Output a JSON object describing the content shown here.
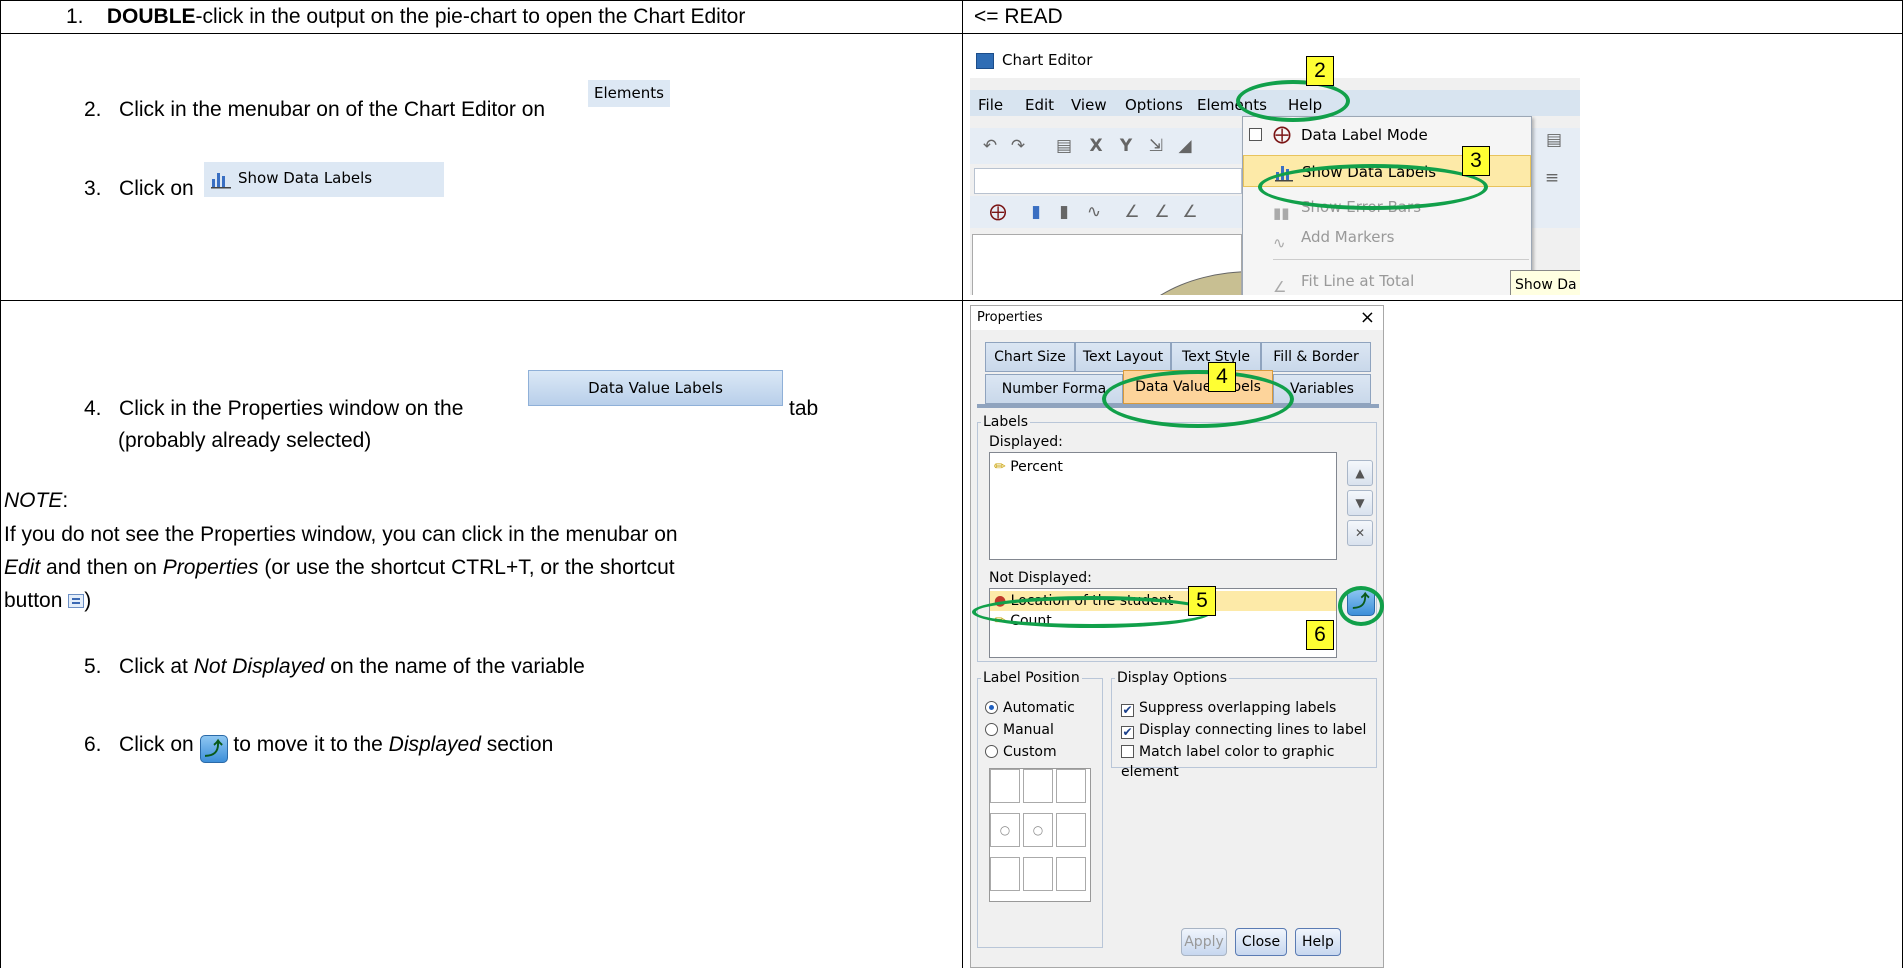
{
  "instructions": {
    "row1": {
      "num": "1.",
      "bold": "DOUBLE",
      "text": "-click in the output on the pie-chart to open the Chart Editor",
      "right": "<= READ"
    },
    "step2": {
      "num": "2.",
      "text": "Click in the menubar on of the Chart Editor on",
      "chip": "Elements"
    },
    "step3": {
      "num": "3.",
      "text": "Click on",
      "chip": "Show Data Labels"
    },
    "step4": {
      "num": "4.",
      "text_before": "Click in the Properties window on the",
      "chip": "Data Value Labels",
      "text_after": "tab",
      "line2": "(probably already selected)"
    },
    "note_label": "NOTE",
    "note_colon": ":",
    "note_line1": "If you do not see the Properties window, you can click in the menubar on",
    "note_edit": "Edit",
    "note_mid": " and then on ",
    "note_properties": "Properties",
    "note_line2_rest": " (or use the shortcut CTRL+T, or the shortcut",
    "note_line3": "button",
    "note_line3_end": ")",
    "step5": {
      "num": "5.",
      "text": "Click at ",
      "italic": "Not Displayed",
      "text_after": " on the name of the variable"
    },
    "step6": {
      "num": "6.",
      "text": "Click on",
      "text_after": " to move it to the ",
      "italic": "Displayed",
      "text_end": " section"
    }
  },
  "chart_editor": {
    "title": "Chart Editor",
    "menus": [
      "File",
      "Edit",
      "View",
      "Options",
      "Elements",
      "Help"
    ],
    "dropdown": {
      "items": [
        "Data Label Mode",
        "Show Data Labels",
        "Show Error Bars",
        "Add Markers",
        "Fit Line at Total"
      ]
    },
    "tooltip": "Show Da"
  },
  "properties": {
    "title": "Properties",
    "close_glyph": "×",
    "tabs_row1": [
      "Chart Size",
      "Text Layout",
      "Text Style",
      "Fill & Border"
    ],
    "tabs_row2": [
      "Number Forma",
      "Data Value Labels",
      "Variables"
    ],
    "labels_group": "Labels",
    "displayed_label": "Displayed:",
    "displayed_items": [
      "Percent"
    ],
    "not_displayed_label": "Not Displayed:",
    "not_displayed_items": [
      "Location of the student",
      "Count"
    ],
    "label_position_group": "Label Position",
    "positions": [
      "Automatic",
      "Manual",
      "Custom"
    ],
    "display_options_group": "Display Options",
    "options": [
      "Suppress overlapping labels",
      "Display connecting lines to label",
      "Match label color to graphic element"
    ],
    "buttons": [
      "Apply",
      "Close",
      "Help"
    ]
  },
  "markers": [
    "2",
    "3",
    "4",
    "5",
    "6"
  ],
  "colors": {
    "ring": "#11a04a",
    "marker": "#ffff33",
    "selected_tab": "#fdd49b",
    "highlight": "#fdeaa8"
  }
}
